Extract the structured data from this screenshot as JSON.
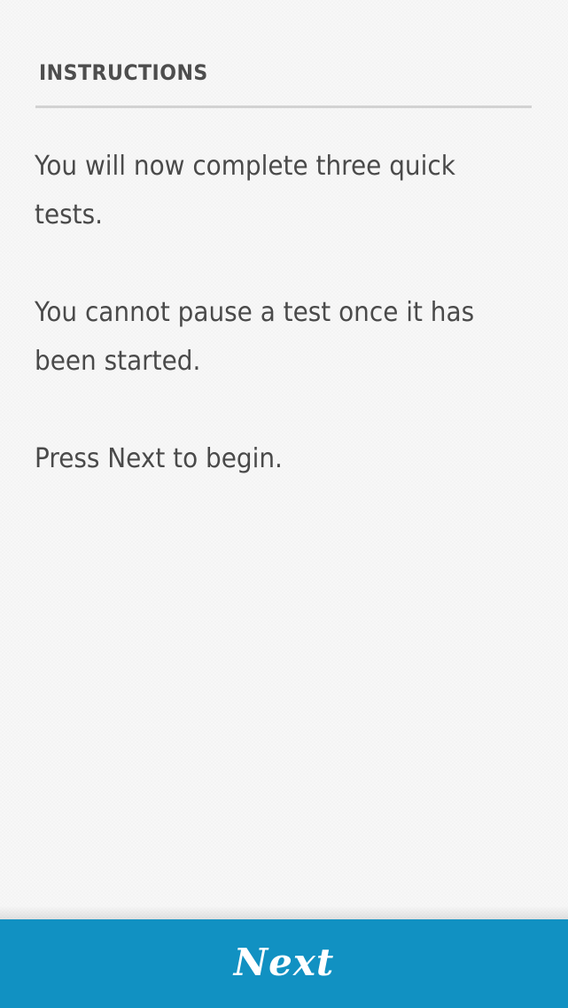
{
  "header": {
    "title": "INSTRUCTIONS"
  },
  "content": {
    "paragraphs": [
      "You will now complete three quick tests.",
      "You cannot pause a test once it has been started.",
      "Press Next to begin."
    ]
  },
  "footer": {
    "next_label": "Next"
  },
  "colors": {
    "background": "#f7f7f7",
    "text": "#4a4a4a",
    "divider": "#d2d2d2",
    "button": "#1191c2",
    "button_text": "#ffffff"
  }
}
